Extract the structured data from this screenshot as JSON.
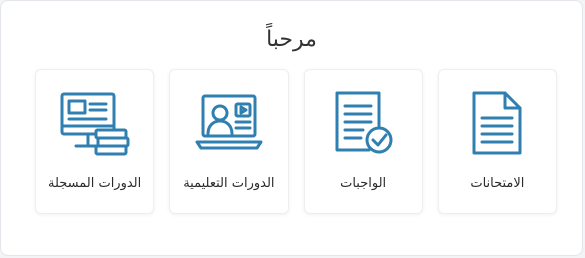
{
  "header": {
    "title": "مرحباً"
  },
  "cards": [
    {
      "label": "الامتحانات",
      "icon": "document-icon"
    },
    {
      "label": "الواجبات",
      "icon": "assignment-check-icon"
    },
    {
      "label": "الدورات التعليمية",
      "icon": "online-lesson-icon"
    },
    {
      "label": "الدورات المسجلة",
      "icon": "computer-books-icon"
    }
  ],
  "colors": {
    "icon": "#2f7fb0",
    "text": "#2b2b2b",
    "background": "#ffffff"
  }
}
